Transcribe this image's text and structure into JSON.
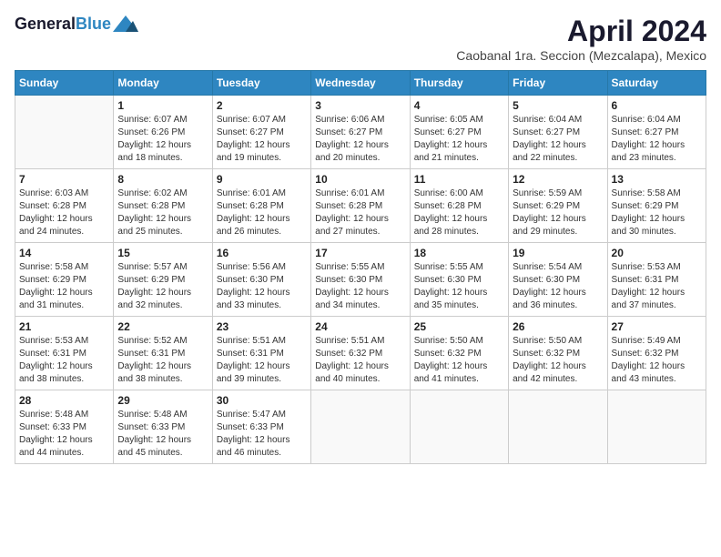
{
  "logo": {
    "text1": "General",
    "text2": "Blue"
  },
  "title": "April 2024",
  "subtitle": "Caobanal 1ra. Seccion (Mezcalapa), Mexico",
  "days_of_week": [
    "Sunday",
    "Monday",
    "Tuesday",
    "Wednesday",
    "Thursday",
    "Friday",
    "Saturday"
  ],
  "weeks": [
    [
      {
        "day": "",
        "sunrise": "",
        "sunset": "",
        "daylight": ""
      },
      {
        "day": "1",
        "sunrise": "Sunrise: 6:07 AM",
        "sunset": "Sunset: 6:26 PM",
        "daylight": "Daylight: 12 hours and 18 minutes."
      },
      {
        "day": "2",
        "sunrise": "Sunrise: 6:07 AM",
        "sunset": "Sunset: 6:27 PM",
        "daylight": "Daylight: 12 hours and 19 minutes."
      },
      {
        "day": "3",
        "sunrise": "Sunrise: 6:06 AM",
        "sunset": "Sunset: 6:27 PM",
        "daylight": "Daylight: 12 hours and 20 minutes."
      },
      {
        "day": "4",
        "sunrise": "Sunrise: 6:05 AM",
        "sunset": "Sunset: 6:27 PM",
        "daylight": "Daylight: 12 hours and 21 minutes."
      },
      {
        "day": "5",
        "sunrise": "Sunrise: 6:04 AM",
        "sunset": "Sunset: 6:27 PM",
        "daylight": "Daylight: 12 hours and 22 minutes."
      },
      {
        "day": "6",
        "sunrise": "Sunrise: 6:04 AM",
        "sunset": "Sunset: 6:27 PM",
        "daylight": "Daylight: 12 hours and 23 minutes."
      }
    ],
    [
      {
        "day": "7",
        "sunrise": "Sunrise: 6:03 AM",
        "sunset": "Sunset: 6:28 PM",
        "daylight": "Daylight: 12 hours and 24 minutes."
      },
      {
        "day": "8",
        "sunrise": "Sunrise: 6:02 AM",
        "sunset": "Sunset: 6:28 PM",
        "daylight": "Daylight: 12 hours and 25 minutes."
      },
      {
        "day": "9",
        "sunrise": "Sunrise: 6:01 AM",
        "sunset": "Sunset: 6:28 PM",
        "daylight": "Daylight: 12 hours and 26 minutes."
      },
      {
        "day": "10",
        "sunrise": "Sunrise: 6:01 AM",
        "sunset": "Sunset: 6:28 PM",
        "daylight": "Daylight: 12 hours and 27 minutes."
      },
      {
        "day": "11",
        "sunrise": "Sunrise: 6:00 AM",
        "sunset": "Sunset: 6:28 PM",
        "daylight": "Daylight: 12 hours and 28 minutes."
      },
      {
        "day": "12",
        "sunrise": "Sunrise: 5:59 AM",
        "sunset": "Sunset: 6:29 PM",
        "daylight": "Daylight: 12 hours and 29 minutes."
      },
      {
        "day": "13",
        "sunrise": "Sunrise: 5:58 AM",
        "sunset": "Sunset: 6:29 PM",
        "daylight": "Daylight: 12 hours and 30 minutes."
      }
    ],
    [
      {
        "day": "14",
        "sunrise": "Sunrise: 5:58 AM",
        "sunset": "Sunset: 6:29 PM",
        "daylight": "Daylight: 12 hours and 31 minutes."
      },
      {
        "day": "15",
        "sunrise": "Sunrise: 5:57 AM",
        "sunset": "Sunset: 6:29 PM",
        "daylight": "Daylight: 12 hours and 32 minutes."
      },
      {
        "day": "16",
        "sunrise": "Sunrise: 5:56 AM",
        "sunset": "Sunset: 6:30 PM",
        "daylight": "Daylight: 12 hours and 33 minutes."
      },
      {
        "day": "17",
        "sunrise": "Sunrise: 5:55 AM",
        "sunset": "Sunset: 6:30 PM",
        "daylight": "Daylight: 12 hours and 34 minutes."
      },
      {
        "day": "18",
        "sunrise": "Sunrise: 5:55 AM",
        "sunset": "Sunset: 6:30 PM",
        "daylight": "Daylight: 12 hours and 35 minutes."
      },
      {
        "day": "19",
        "sunrise": "Sunrise: 5:54 AM",
        "sunset": "Sunset: 6:30 PM",
        "daylight": "Daylight: 12 hours and 36 minutes."
      },
      {
        "day": "20",
        "sunrise": "Sunrise: 5:53 AM",
        "sunset": "Sunset: 6:31 PM",
        "daylight": "Daylight: 12 hours and 37 minutes."
      }
    ],
    [
      {
        "day": "21",
        "sunrise": "Sunrise: 5:53 AM",
        "sunset": "Sunset: 6:31 PM",
        "daylight": "Daylight: 12 hours and 38 minutes."
      },
      {
        "day": "22",
        "sunrise": "Sunrise: 5:52 AM",
        "sunset": "Sunset: 6:31 PM",
        "daylight": "Daylight: 12 hours and 38 minutes."
      },
      {
        "day": "23",
        "sunrise": "Sunrise: 5:51 AM",
        "sunset": "Sunset: 6:31 PM",
        "daylight": "Daylight: 12 hours and 39 minutes."
      },
      {
        "day": "24",
        "sunrise": "Sunrise: 5:51 AM",
        "sunset": "Sunset: 6:32 PM",
        "daylight": "Daylight: 12 hours and 40 minutes."
      },
      {
        "day": "25",
        "sunrise": "Sunrise: 5:50 AM",
        "sunset": "Sunset: 6:32 PM",
        "daylight": "Daylight: 12 hours and 41 minutes."
      },
      {
        "day": "26",
        "sunrise": "Sunrise: 5:50 AM",
        "sunset": "Sunset: 6:32 PM",
        "daylight": "Daylight: 12 hours and 42 minutes."
      },
      {
        "day": "27",
        "sunrise": "Sunrise: 5:49 AM",
        "sunset": "Sunset: 6:32 PM",
        "daylight": "Daylight: 12 hours and 43 minutes."
      }
    ],
    [
      {
        "day": "28",
        "sunrise": "Sunrise: 5:48 AM",
        "sunset": "Sunset: 6:33 PM",
        "daylight": "Daylight: 12 hours and 44 minutes."
      },
      {
        "day": "29",
        "sunrise": "Sunrise: 5:48 AM",
        "sunset": "Sunset: 6:33 PM",
        "daylight": "Daylight: 12 hours and 45 minutes."
      },
      {
        "day": "30",
        "sunrise": "Sunrise: 5:47 AM",
        "sunset": "Sunset: 6:33 PM",
        "daylight": "Daylight: 12 hours and 46 minutes."
      },
      {
        "day": "",
        "sunrise": "",
        "sunset": "",
        "daylight": ""
      },
      {
        "day": "",
        "sunrise": "",
        "sunset": "",
        "daylight": ""
      },
      {
        "day": "",
        "sunrise": "",
        "sunset": "",
        "daylight": ""
      },
      {
        "day": "",
        "sunrise": "",
        "sunset": "",
        "daylight": ""
      }
    ]
  ]
}
